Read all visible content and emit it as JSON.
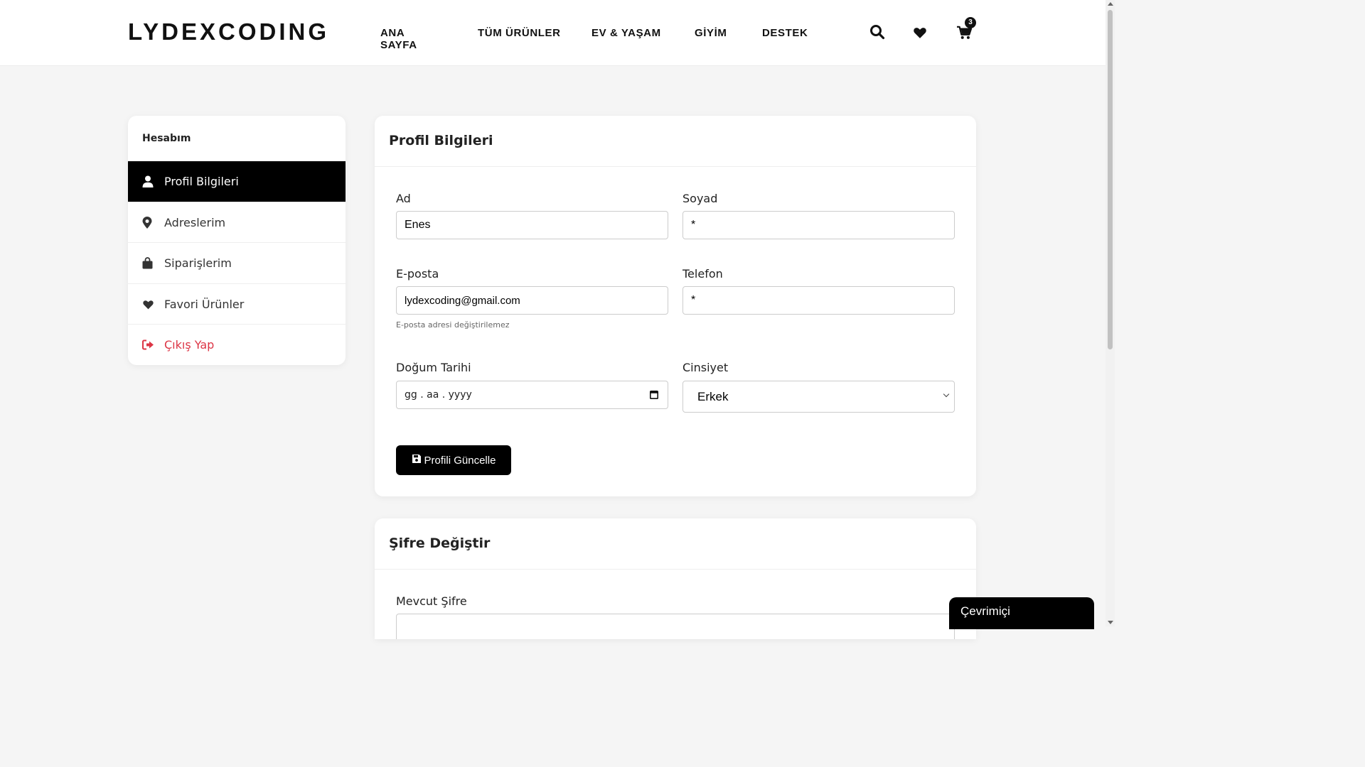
{
  "brand": {
    "logo": "LYDEXCODING"
  },
  "nav": {
    "items": [
      {
        "label": "ANA SAYFA"
      },
      {
        "label": "TÜM ÜRÜNLER"
      },
      {
        "label": "EV & YAŞAM"
      },
      {
        "label": "GİYİM"
      },
      {
        "label": "DESTEK"
      }
    ]
  },
  "header_icons": {
    "search": "search-icon",
    "wishlist": "heart-icon",
    "cart": "cart-icon",
    "cart_count": "3"
  },
  "sidebar": {
    "title": "Hesabım",
    "items": [
      {
        "label": "Profil Bilgileri",
        "icon": "user-icon",
        "active": true
      },
      {
        "label": "Adreslerim",
        "icon": "map-pin-icon"
      },
      {
        "label": "Siparişlerim",
        "icon": "shopping-bag-icon"
      },
      {
        "label": "Favori Ürünler",
        "icon": "heart-icon"
      },
      {
        "label": "Çıkış Yap",
        "icon": "sign-out-icon",
        "color": "#dc3545"
      }
    ]
  },
  "profile": {
    "title": "Profil Bilgileri",
    "first_name": {
      "label": "Ad",
      "value": "Enes"
    },
    "last_name": {
      "label": "Soyad",
      "value": "*"
    },
    "email": {
      "label": "E-posta",
      "value": "lydexcoding@gmail.com",
      "hint": "E-posta adresi değiştirilemez"
    },
    "phone": {
      "label": "Telefon",
      "value": "*"
    },
    "birth_date": {
      "label": "Doğum Tarihi",
      "placeholder": "gg . aa . yyyy"
    },
    "gender": {
      "label": "Cinsiyet",
      "value": "Erkek"
    },
    "save_button": "Profili Güncelle"
  },
  "password": {
    "title": "Şifre Değiştir",
    "current_label": "Mevcut Şifre"
  },
  "chat": {
    "label": "Çevrimiçi"
  },
  "colors": {
    "accent": "#000000",
    "danger": "#dc3545",
    "background": "#f5f5f5"
  }
}
